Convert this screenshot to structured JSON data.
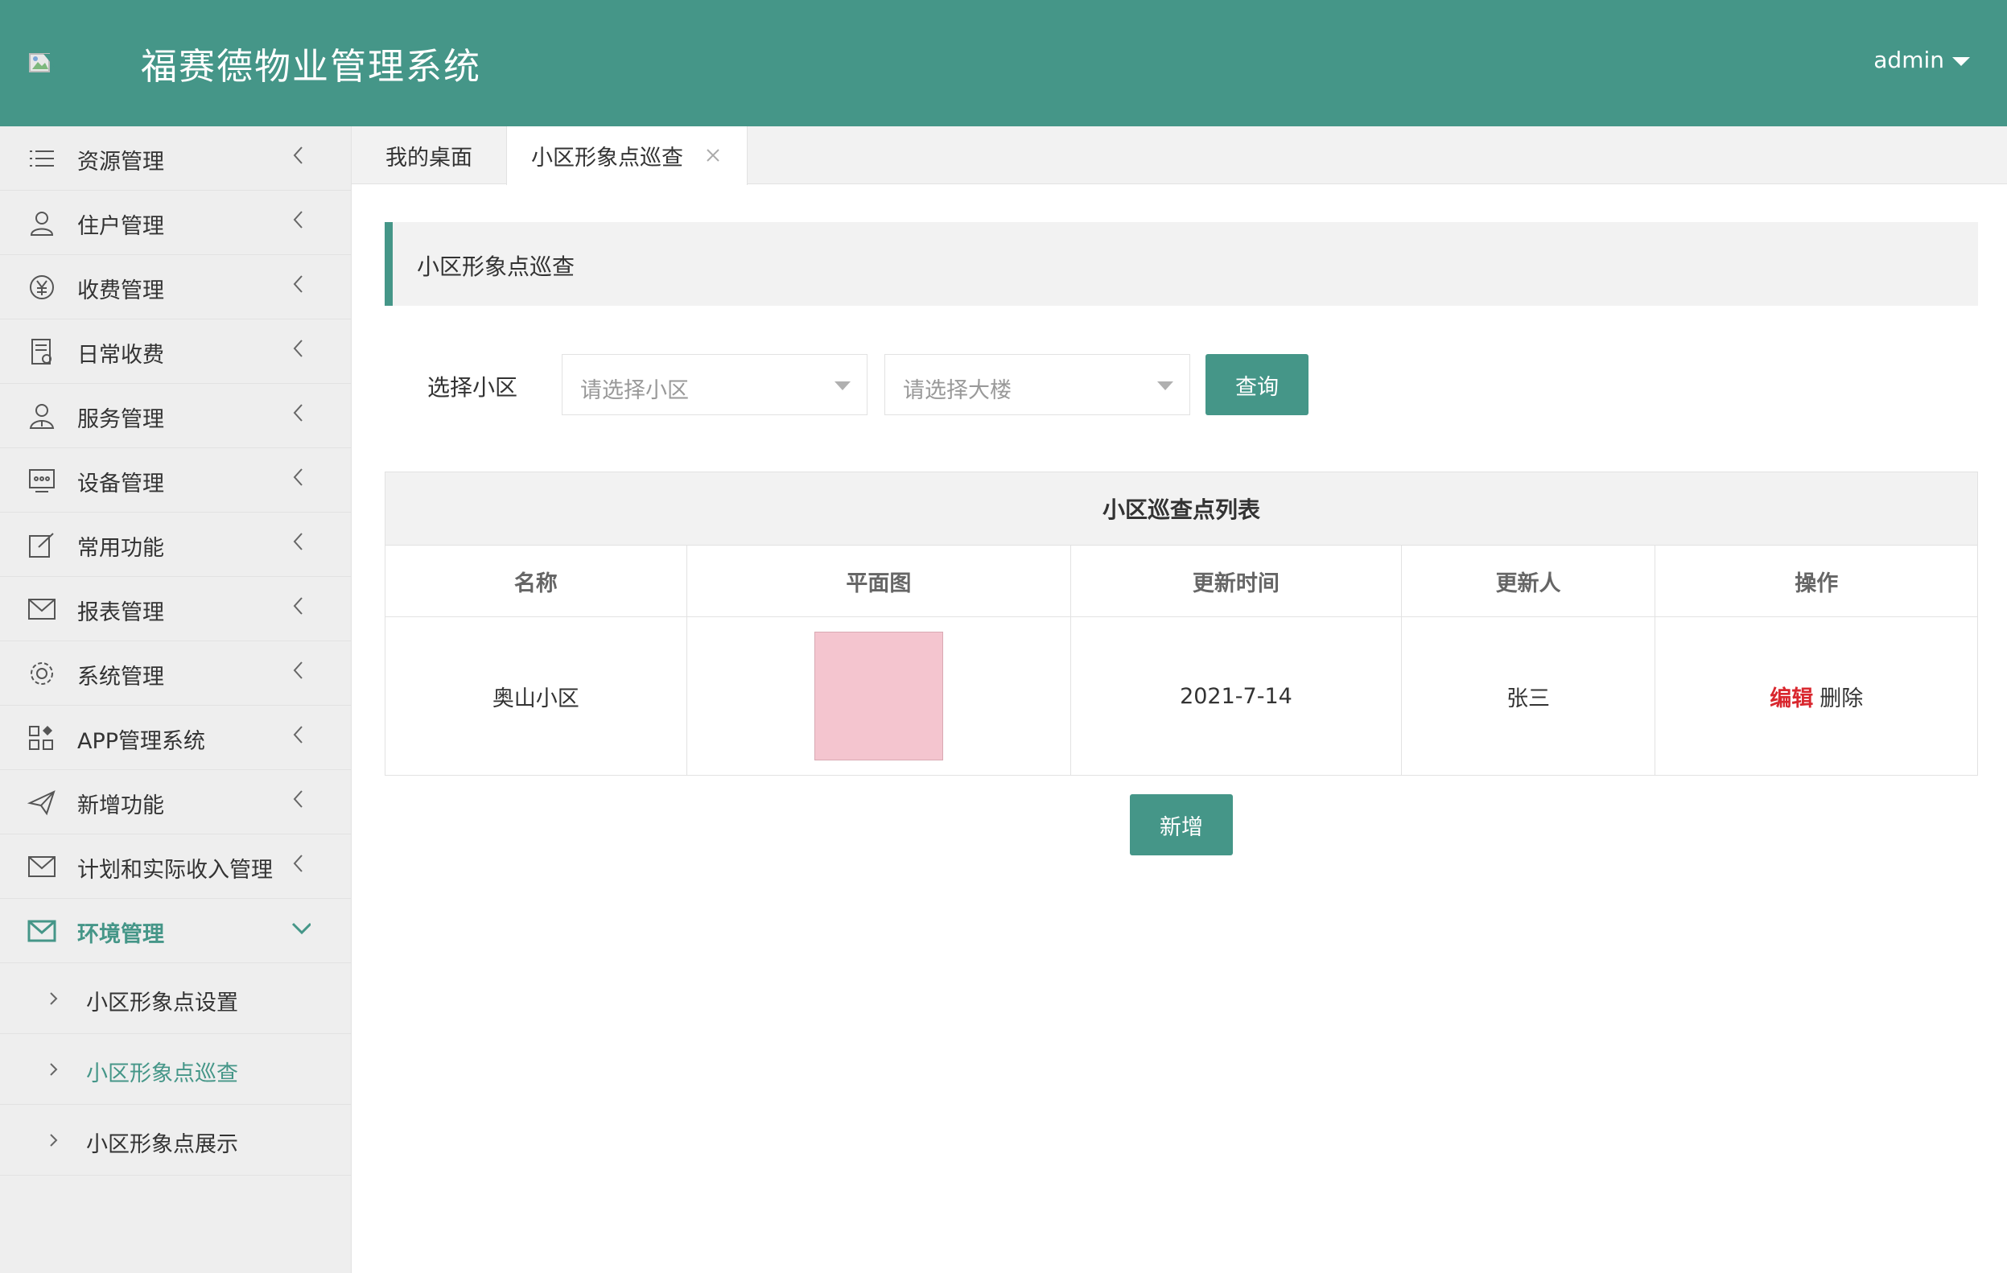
{
  "header": {
    "title": "福赛德物业管理系统",
    "user": "admin",
    "logo_icon": "broken-image-icon",
    "bg_color": "#459688"
  },
  "sidebar": {
    "items": [
      {
        "label": "资源管理",
        "icon": "list-icon"
      },
      {
        "label": "住户管理",
        "icon": "user-icon"
      },
      {
        "label": "收费管理",
        "icon": "yen-icon"
      },
      {
        "label": "日常收费",
        "icon": "document-icon"
      },
      {
        "label": "服务管理",
        "icon": "person-icon"
      },
      {
        "label": "设备管理",
        "icon": "device-icon"
      },
      {
        "label": "常用功能",
        "icon": "edit-icon"
      },
      {
        "label": "报表管理",
        "icon": "mail-icon"
      },
      {
        "label": "系统管理",
        "icon": "gear-icon"
      },
      {
        "label": "APP管理系统",
        "icon": "apps-icon"
      },
      {
        "label": "新增功能",
        "icon": "send-icon"
      },
      {
        "label": "计划和实际收入管理",
        "icon": "mail-icon"
      },
      {
        "label": "环境管理",
        "icon": "mail-icon",
        "active": true
      }
    ],
    "subitems": [
      {
        "label": "小区形象点设置"
      },
      {
        "label": "小区形象点巡查",
        "active": true
      },
      {
        "label": "小区形象点展示"
      }
    ],
    "accent_color": "#459688"
  },
  "tabs": [
    {
      "label": "我的桌面"
    },
    {
      "label": "小区形象点巡查",
      "closable": true
    }
  ],
  "page": {
    "title": "小区形象点巡查"
  },
  "filter": {
    "label": "选择小区",
    "community_placeholder": "请选择小区",
    "building_placeholder": "请选择大楼",
    "query_button": "查询"
  },
  "table": {
    "caption": "小区巡查点列表",
    "columns": [
      "名称",
      "平面图",
      "更新时间",
      "更新人",
      "操作"
    ],
    "rows": [
      {
        "name": "奥山小区",
        "updated_at": "2021-7-14",
        "updated_by": "张三",
        "edit": "编辑",
        "delete": "删除"
      }
    ]
  },
  "add_button": "新增"
}
